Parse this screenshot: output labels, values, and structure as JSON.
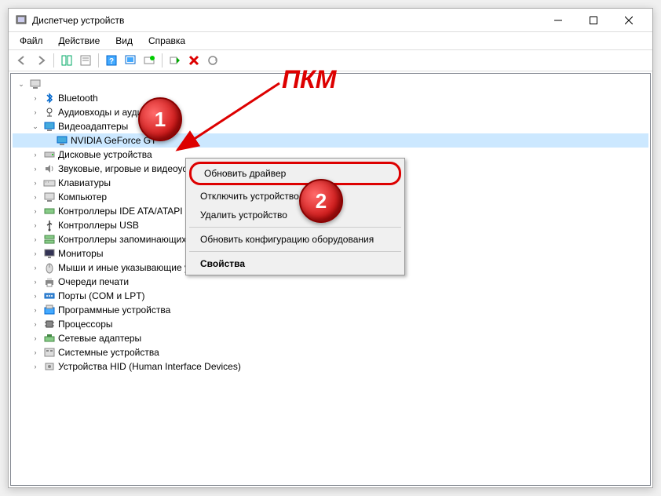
{
  "window": {
    "title": "Диспетчер устройств"
  },
  "menubar": {
    "file": "Файл",
    "action": "Действие",
    "view": "Вид",
    "help": "Справка"
  },
  "tree": {
    "root": "",
    "items": [
      {
        "label": "Bluetooth",
        "icon": "bluetooth"
      },
      {
        "label": "Аудиовходы и аудиовыходы",
        "icon": "audio"
      },
      {
        "label": "Видеоадаптеры",
        "icon": "display",
        "expanded": true,
        "children": [
          {
            "label": "NVIDIA GeForce GT",
            "icon": "display",
            "selected": true
          }
        ]
      },
      {
        "label": "Дисковые устройства",
        "icon": "disk"
      },
      {
        "label": "Звуковые, игровые и видеоустройства",
        "icon": "sound"
      },
      {
        "label": "Клавиатуры",
        "icon": "keyboard"
      },
      {
        "label": "Компьютер",
        "icon": "computer"
      },
      {
        "label": "Контроллеры IDE ATA/ATAPI",
        "icon": "ide"
      },
      {
        "label": "Контроллеры USB",
        "icon": "usb"
      },
      {
        "label": "Контроллеры запоминающих устройств",
        "icon": "storage"
      },
      {
        "label": "Мониторы",
        "icon": "monitor"
      },
      {
        "label": "Мыши и иные указывающие устройства",
        "icon": "mouse"
      },
      {
        "label": "Очереди печати",
        "icon": "printer"
      },
      {
        "label": "Порты (COM и LPT)",
        "icon": "port"
      },
      {
        "label": "Программные устройства",
        "icon": "software"
      },
      {
        "label": "Процессоры",
        "icon": "cpu"
      },
      {
        "label": "Сетевые адаптеры",
        "icon": "network"
      },
      {
        "label": "Системные устройства",
        "icon": "system"
      },
      {
        "label": "Устройства HID (Human Interface Devices)",
        "icon": "hid"
      }
    ]
  },
  "contextMenu": {
    "updateDriver": "Обновить драйвер",
    "disableDevice": "Отключить устройство",
    "removeDevice": "Удалить устройство",
    "updateConfig": "Обновить конфигурацию оборудования",
    "properties": "Свойства"
  },
  "annotations": {
    "circle1": "1",
    "circle2": "2",
    "label": "ПКМ"
  }
}
